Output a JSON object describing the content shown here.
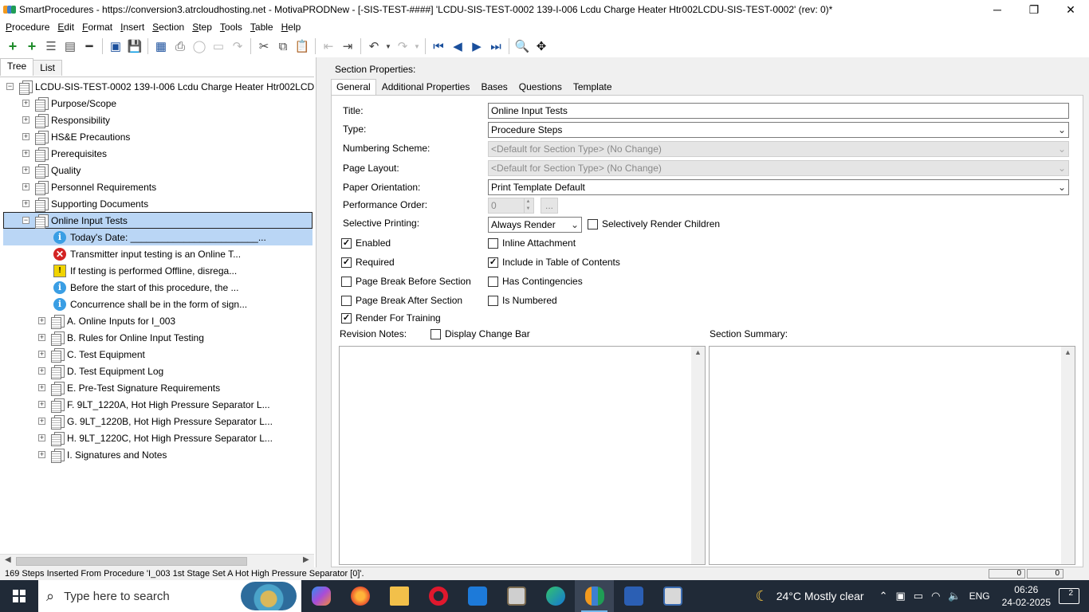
{
  "window": {
    "title": "SmartProcedures - https://conversion3.atrcloudhosting.net - MotivaPRODNew - [-SIS-TEST-####] 'LCDU-SIS-TEST-0002 139-I-006 Lcdu Charge Heater Htr002LCDU-SIS-TEST-0002' (rev: 0)*",
    "minimize": "─",
    "maximize": "❐",
    "close": "✕"
  },
  "menu": [
    {
      "label": "Procedure",
      "u": "P",
      "rest": "rocedure"
    },
    {
      "label": "Edit",
      "u": "E",
      "rest": "dit"
    },
    {
      "label": "Format",
      "u": "F",
      "rest": "ormat"
    },
    {
      "label": "Insert",
      "u": "I",
      "rest": "nsert"
    },
    {
      "label": "Section",
      "u": "S",
      "rest": "ection"
    },
    {
      "label": "Step",
      "u": "S",
      "rest": "tep"
    },
    {
      "label": "Tools",
      "u": "T",
      "rest": "ools"
    },
    {
      "label": "Table",
      "u": "T",
      "rest": "able"
    },
    {
      "label": "Help",
      "u": "H",
      "rest": "elp"
    }
  ],
  "left_tabs": {
    "tree": "Tree",
    "list": "List"
  },
  "tree": {
    "root": "LCDU-SIS-TEST-0002  139-I-006  Lcdu  Charge  Heater  Htr002LCDU...",
    "sections": [
      "Purpose/Scope",
      "Responsibility",
      "HS&E Precautions",
      "Prerequisites",
      "Quality",
      "Personnel Requirements",
      "Supporting Documents",
      "Online Input Tests"
    ],
    "steps": [
      {
        "icon": "info",
        "text": "Today's Date: ________________________..."
      },
      {
        "icon": "error",
        "text": "Transmitter input testing is an Online T..."
      },
      {
        "icon": "warning",
        "text": "If testing is performed Offline, disrega..."
      },
      {
        "icon": "info",
        "text": "Before the start of this procedure, the ..."
      },
      {
        "icon": "info",
        "text": "Concurrence shall be in the form of sign..."
      }
    ],
    "subsections": [
      "A. Online Inputs for I_003",
      "B. Rules for Online Input Testing",
      "C. Test Equipment",
      "D. Test Equipment Log",
      "E. Pre-Test Signature Requirements",
      "F. 9LT_1220A, Hot High Pressure Separator L...",
      "G. 9LT_1220B, Hot High Pressure Separator L...",
      "H. 9LT_1220C, Hot High Pressure Separator L...",
      "I. Signatures and Notes"
    ]
  },
  "section_properties": {
    "label": "Section Properties:",
    "tabs": [
      "General",
      "Additional Properties",
      "Bases",
      "Questions",
      "Template"
    ],
    "title_label": "Title:",
    "title_value": "Online Input Tests",
    "type_label": "Type:",
    "type_value": "Procedure Steps",
    "numbering_label": "Numbering Scheme:",
    "numbering_value": "<Default for Section Type> (No Change)",
    "layout_label": "Page Layout:",
    "layout_value": "<Default for Section Type> (No Change)",
    "orientation_label": "Paper Orientation:",
    "orientation_value": "Print Template Default",
    "perf_label": "Performance Order:",
    "perf_value": "0",
    "perf_button": "...",
    "selective_label": "Selective Printing:",
    "selective_value": "Always Render",
    "selective_children": "Selectively Render Children",
    "checks": {
      "enabled": "Enabled",
      "required": "Required",
      "page_break_before": "Page Break Before Section",
      "page_break_after": "Page Break After Section",
      "render_training": "Render For Training",
      "inline_attachment": "Inline Attachment",
      "include_toc": "Include in Table of Contents",
      "has_contingencies": "Has Contingencies",
      "is_numbered": "Is Numbered"
    },
    "revision_notes": "Revision Notes:",
    "display_change_bar": "Display Change Bar",
    "section_summary": "Section Summary:"
  },
  "status": {
    "message": "169 Steps Inserted From Procedure 'I_003 1st Stage Set A Hot High Pressure Separator [0]'.",
    "pane1": "0",
    "pane2": "0"
  },
  "taskbar": {
    "search_placeholder": "Type here to search",
    "weather": "24°C  Mostly clear",
    "lang": "ENG",
    "time": "06:26",
    "date": "24-02-2025",
    "notifications": "2"
  }
}
